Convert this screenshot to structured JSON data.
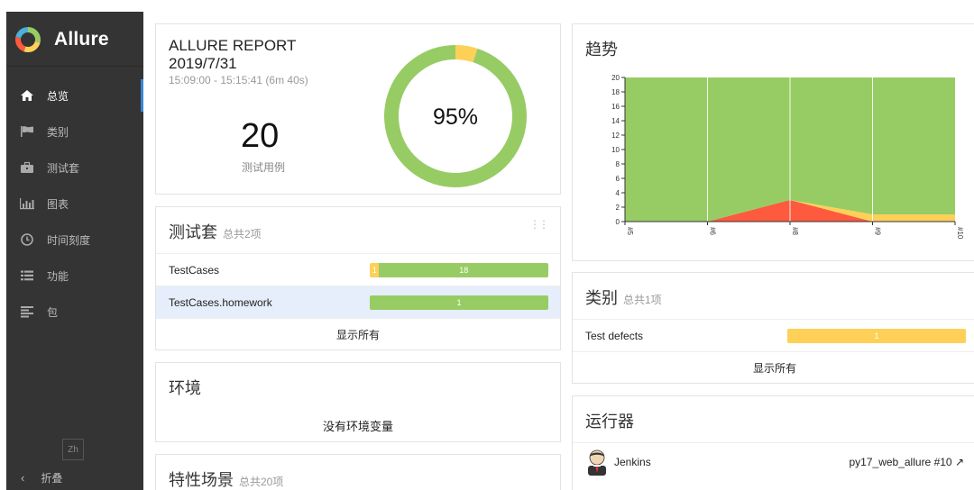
{
  "app": {
    "name": "Allure"
  },
  "sidebar": {
    "items": [
      {
        "label": "总览",
        "icon": "home-icon"
      },
      {
        "label": "类别",
        "icon": "flag-icon"
      },
      {
        "label": "测试套",
        "icon": "briefcase-icon"
      },
      {
        "label": "图表",
        "icon": "bar-chart-icon"
      },
      {
        "label": "时间刻度",
        "icon": "clock-icon"
      },
      {
        "label": "功能",
        "icon": "list-icon"
      },
      {
        "label": "包",
        "icon": "align-left-icon"
      }
    ],
    "lang": "Zh",
    "collapse_label": "折叠"
  },
  "summary": {
    "title": "ALLURE REPORT",
    "date": "2019/7/31",
    "time": "15:09:00 - 15:15:41 (6m 40s)",
    "count": "20",
    "count_label": "测试用例",
    "percent": "95%",
    "passed_fraction": 0.95,
    "colors": {
      "passed": "#97cc64",
      "broken": "#fed058"
    }
  },
  "suites": {
    "title": "测试套",
    "subtitle": "总共2项",
    "rows": [
      {
        "name": "TestCases",
        "broken": "1",
        "passed": "18",
        "broken_share": 0.053,
        "passed_share": 0.947
      },
      {
        "name": "TestCases.homework",
        "broken": "",
        "passed": "1",
        "broken_share": 0,
        "passed_share": 1
      }
    ],
    "show_all": "显示所有"
  },
  "environment": {
    "title": "环境",
    "message": "没有环境变量"
  },
  "features": {
    "title": "特性场景",
    "subtitle": "总共20项"
  },
  "trend": {
    "title": "趋势"
  },
  "chart_data": {
    "type": "area",
    "title": "趋势",
    "categories": [
      "#5",
      "#6",
      "#8",
      "#9",
      "#10"
    ],
    "ylim": [
      0,
      20
    ],
    "yticks": [
      "0",
      "2",
      "4",
      "6",
      "8",
      "10",
      "12",
      "14",
      "16",
      "18",
      "20"
    ],
    "series": [
      {
        "values": [
          0,
          0,
          3,
          0,
          0
        ],
        "color": "#fd5a3e"
      },
      {
        "values": [
          0,
          0,
          0,
          1,
          1
        ],
        "color": "#fed058"
      },
      {
        "values": [
          20,
          20,
          17,
          19,
          19
        ],
        "color": "#97cc64"
      }
    ],
    "grid": true
  },
  "categories": {
    "title": "类别",
    "subtitle": "总共1项",
    "rows": [
      {
        "name": "Test defects",
        "value": "1"
      }
    ],
    "show_all": "显示所有"
  },
  "executors": {
    "title": "运行器",
    "rows": [
      {
        "name": "Jenkins",
        "build": "py17_web_allure #10"
      }
    ]
  }
}
